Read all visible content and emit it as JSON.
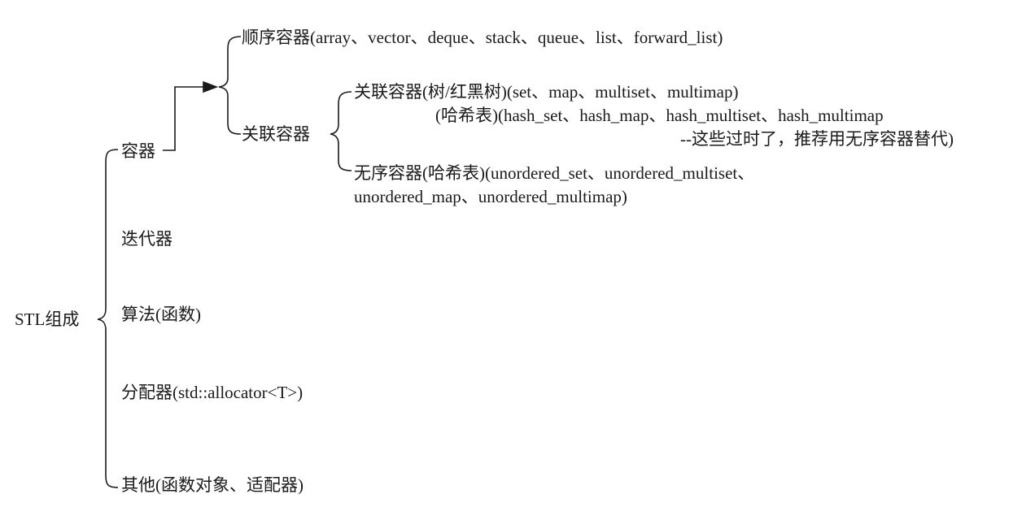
{
  "root": {
    "label": "STL组成"
  },
  "branches": {
    "containers": "容器",
    "iterators": "迭代器",
    "algorithms": "算法(函数)",
    "allocator": "分配器(std::allocator<T>)",
    "others": "其他(函数对象、适配器)"
  },
  "containers": {
    "sequence": "顺序容器(array、vector、deque、stack、queue、list、forward_list)",
    "associative": "关联容器"
  },
  "associative": {
    "tree_line": "关联容器(树/红黑树)(set、map、multiset、multimap)",
    "hash_line": "(哈希表)(hash_set、hash_map、hash_multiset、hash_multimap",
    "hash_note": "--这些过时了，推荐用无序容器替代)",
    "unordered_line1": "无序容器(哈希表)(unordered_set、unordered_multiset、",
    "unordered_line2": "unordered_map、unordered_multimap)"
  }
}
